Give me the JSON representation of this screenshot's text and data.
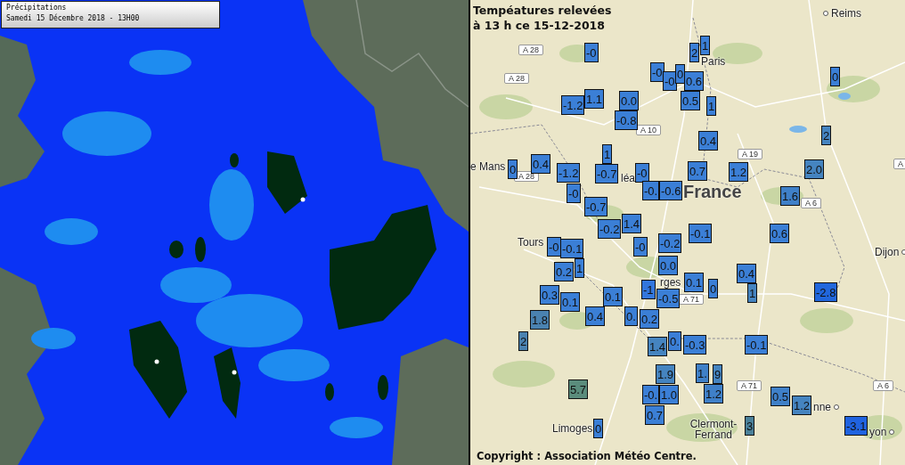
{
  "radar_panel": {
    "title": "Précipitations",
    "subtitle": "Samedi 15 Décembre 2018 - 13H00"
  },
  "temperature_map": {
    "title_lines": [
      "Tempéatures relevées",
      "à 13 h ce 15-12-2018"
    ],
    "places": [
      {
        "name": "Reims",
        "dot": true
      },
      {
        "name": "Paris",
        "dot": false
      },
      {
        "name": "e Mans",
        "dot": false
      },
      {
        "name": "léa",
        "dot": false
      },
      {
        "name": "Tours",
        "dot": false
      },
      {
        "name": "rges",
        "dot": false
      },
      {
        "name": "Dijon",
        "dot": true
      },
      {
        "name": "Limoges",
        "dot": false
      },
      {
        "name": "Clermont-Ferrand",
        "dot": false
      },
      {
        "name": "nne",
        "dot": true
      },
      {
        "name": "yon",
        "dot": true
      }
    ],
    "country_label": "France",
    "road_signs": [
      "A 28",
      "A 28",
      "A 28",
      "A 10",
      "A 19",
      "A 6",
      "A",
      "A 71",
      "A 71",
      "A 6"
    ],
    "markers": [
      {
        "value": "-0",
        "color": "#3b7fd6"
      },
      {
        "value": "2",
        "color": "#3b7fd6"
      },
      {
        "value": "1",
        "color": "#3b7fd6"
      },
      {
        "value": "-0",
        "color": "#3b7fd6"
      },
      {
        "value": "-0",
        "color": "#3b7fd6"
      },
      {
        "value": "0",
        "color": "#3b7fd6"
      },
      {
        "value": "0.6",
        "color": "#3b7fd6"
      },
      {
        "value": "0",
        "color": "#3b7fd6"
      },
      {
        "value": "-1.2",
        "color": "#3b7fd6"
      },
      {
        "value": "1.1",
        "color": "#3b7fd6"
      },
      {
        "value": "0.0",
        "color": "#3b7fd6"
      },
      {
        "value": "0.5",
        "color": "#3b7fd6"
      },
      {
        "value": "1",
        "color": "#3b7fd6"
      },
      {
        "value": "-0.8",
        "color": "#3b7fd6"
      },
      {
        "value": "2",
        "color": "#4584c0"
      },
      {
        "value": "0.4",
        "color": "#3b7fd6"
      },
      {
        "value": "1",
        "color": "#3b7fd6"
      },
      {
        "value": "0",
        "color": "#3b7fd6"
      },
      {
        "value": "0.4",
        "color": "#3b7fd6"
      },
      {
        "value": "-1.2",
        "color": "#3b7fd6"
      },
      {
        "value": "-0.7",
        "color": "#3b7fd6"
      },
      {
        "value": "-0",
        "color": "#3b7fd6"
      },
      {
        "value": "0.7",
        "color": "#3b7fd6"
      },
      {
        "value": "1.2",
        "color": "#3b7fd6"
      },
      {
        "value": "2.0",
        "color": "#4584c0"
      },
      {
        "value": "-0",
        "color": "#3b7fd6"
      },
      {
        "value": "-0.",
        "color": "#3b7fd6"
      },
      {
        "value": "-0.6",
        "color": "#3b7fd6"
      },
      {
        "value": "1.6",
        "color": "#3f80c8"
      },
      {
        "value": "-0.7",
        "color": "#3b7fd6"
      },
      {
        "value": "-0.2",
        "color": "#3b7fd6"
      },
      {
        "value": "1.4",
        "color": "#3b7fd6"
      },
      {
        "value": "-0.1",
        "color": "#3b7fd6"
      },
      {
        "value": "0.6",
        "color": "#3b7fd6"
      },
      {
        "value": "-0",
        "color": "#3b7fd6"
      },
      {
        "value": "-0.1",
        "color": "#3b7fd6"
      },
      {
        "value": "-0",
        "color": "#3b7fd6"
      },
      {
        "value": "-0.2",
        "color": "#3b7fd6"
      },
      {
        "value": "0.2",
        "color": "#3b7fd6"
      },
      {
        "value": "1",
        "color": "#3b7fd6"
      },
      {
        "value": "0.0",
        "color": "#3b7fd6"
      },
      {
        "value": "0.4",
        "color": "#3b7fd6"
      },
      {
        "value": "0.3",
        "color": "#3b7fd6"
      },
      {
        "value": "0.1",
        "color": "#3b7fd6"
      },
      {
        "value": "0.1",
        "color": "#3b7fd6"
      },
      {
        "value": "-1",
        "color": "#3377dd"
      },
      {
        "value": "-0.5",
        "color": "#3b7fd6"
      },
      {
        "value": "0.1",
        "color": "#3b7fd6"
      },
      {
        "value": "0",
        "color": "#3b7fd6"
      },
      {
        "value": "1",
        "color": "#4584c0"
      },
      {
        "value": "-2.8",
        "color": "#2167dc"
      },
      {
        "value": "1.8",
        "color": "#4a82b0"
      },
      {
        "value": "0.4",
        "color": "#3b7fd6"
      },
      {
        "value": "0.",
        "color": "#3b7fd6"
      },
      {
        "value": "0.2",
        "color": "#3b7fd6"
      },
      {
        "value": "2",
        "color": "#4a82b0"
      },
      {
        "value": "1.4",
        "color": "#4584c0"
      },
      {
        "value": "0.",
        "color": "#3b7fd6"
      },
      {
        "value": "-0.3",
        "color": "#3b7fd6"
      },
      {
        "value": "-0.1",
        "color": "#3b7fd6"
      },
      {
        "value": "1.9",
        "color": "#4584c0"
      },
      {
        "value": "1.",
        "color": "#3f80c8"
      },
      {
        "value": "9",
        "color": "#4584c0"
      },
      {
        "value": "5.7",
        "color": "#5a8c7c"
      },
      {
        "value": "-0.",
        "color": "#3b7fd6"
      },
      {
        "value": "1.0",
        "color": "#3b7fd6"
      },
      {
        "value": "1.2",
        "color": "#3f80c8"
      },
      {
        "value": "0.5",
        "color": "#3f80c8"
      },
      {
        "value": "1.2",
        "color": "#4584c0"
      },
      {
        "value": "0.7",
        "color": "#3b7fd6"
      },
      {
        "value": "0",
        "color": "#3b7fd6"
      },
      {
        "value": "3",
        "color": "#4a8099"
      },
      {
        "value": "-3.1",
        "color": "#2063e0"
      }
    ],
    "copyright": "Copyright : Association Météo Centre."
  }
}
